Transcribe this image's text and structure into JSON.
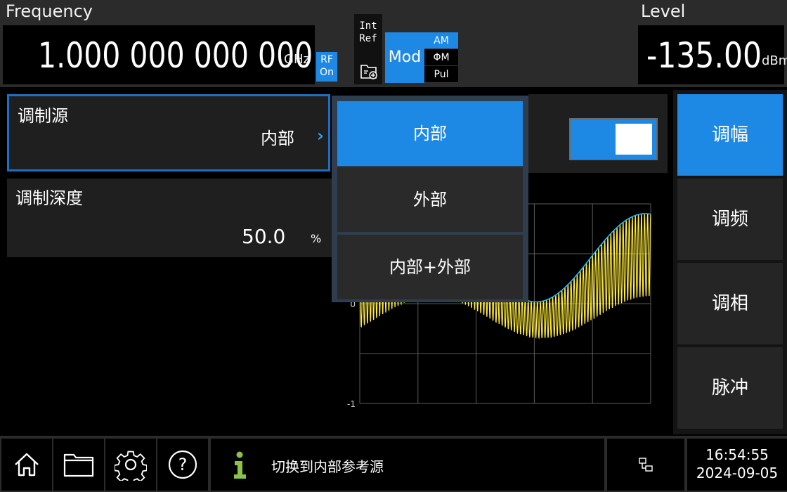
{
  "header": {
    "frequency_label": "Frequency",
    "frequency_value": "1.000 000 000 000",
    "frequency_unit": "GHz",
    "rf_line1": "RF",
    "rf_line2": "On",
    "ref_line1": "Int",
    "ref_line2": "Ref",
    "mod_label": "Mod",
    "mod_am": "AM",
    "mod_phim": "ΦM",
    "mod_pul": "Pul",
    "level_label": "Level",
    "level_value": "-135.00",
    "level_unit": "dBm"
  },
  "params": {
    "source_title": "调制源",
    "source_value": "内部",
    "depth_title": "调制深度",
    "depth_value": "50.0",
    "depth_unit": "%"
  },
  "dropdown": {
    "options": [
      "内部",
      "外部",
      "内部+外部"
    ],
    "selected_index": 0
  },
  "toggle": {
    "state": "on"
  },
  "chart_data": {
    "type": "line",
    "ytick_labels": [
      "0",
      "-1"
    ],
    "series": [
      {
        "description": "am-modulated-carrier",
        "color": "#ffeb3b"
      },
      {
        "description": "modulating-envelope",
        "color": "#29b6f6"
      }
    ]
  },
  "softkeys": [
    "调幅",
    "调频",
    "调相",
    "脉冲"
  ],
  "softkey_active": "调幅",
  "status": {
    "message": "切换到内部参考源",
    "time": "16:54:55",
    "date": "2024-09-05"
  },
  "colors": {
    "accent": "#1e88e5",
    "chevron": "#2f9df0",
    "info": "#8bc34a",
    "trace": "#ffeb3b",
    "envelope": "#29b6f6"
  },
  "icons": [
    "home-icon",
    "folder-icon",
    "gear-icon",
    "help-icon",
    "info-icon",
    "network-icon",
    "chevron-right-icon"
  ]
}
